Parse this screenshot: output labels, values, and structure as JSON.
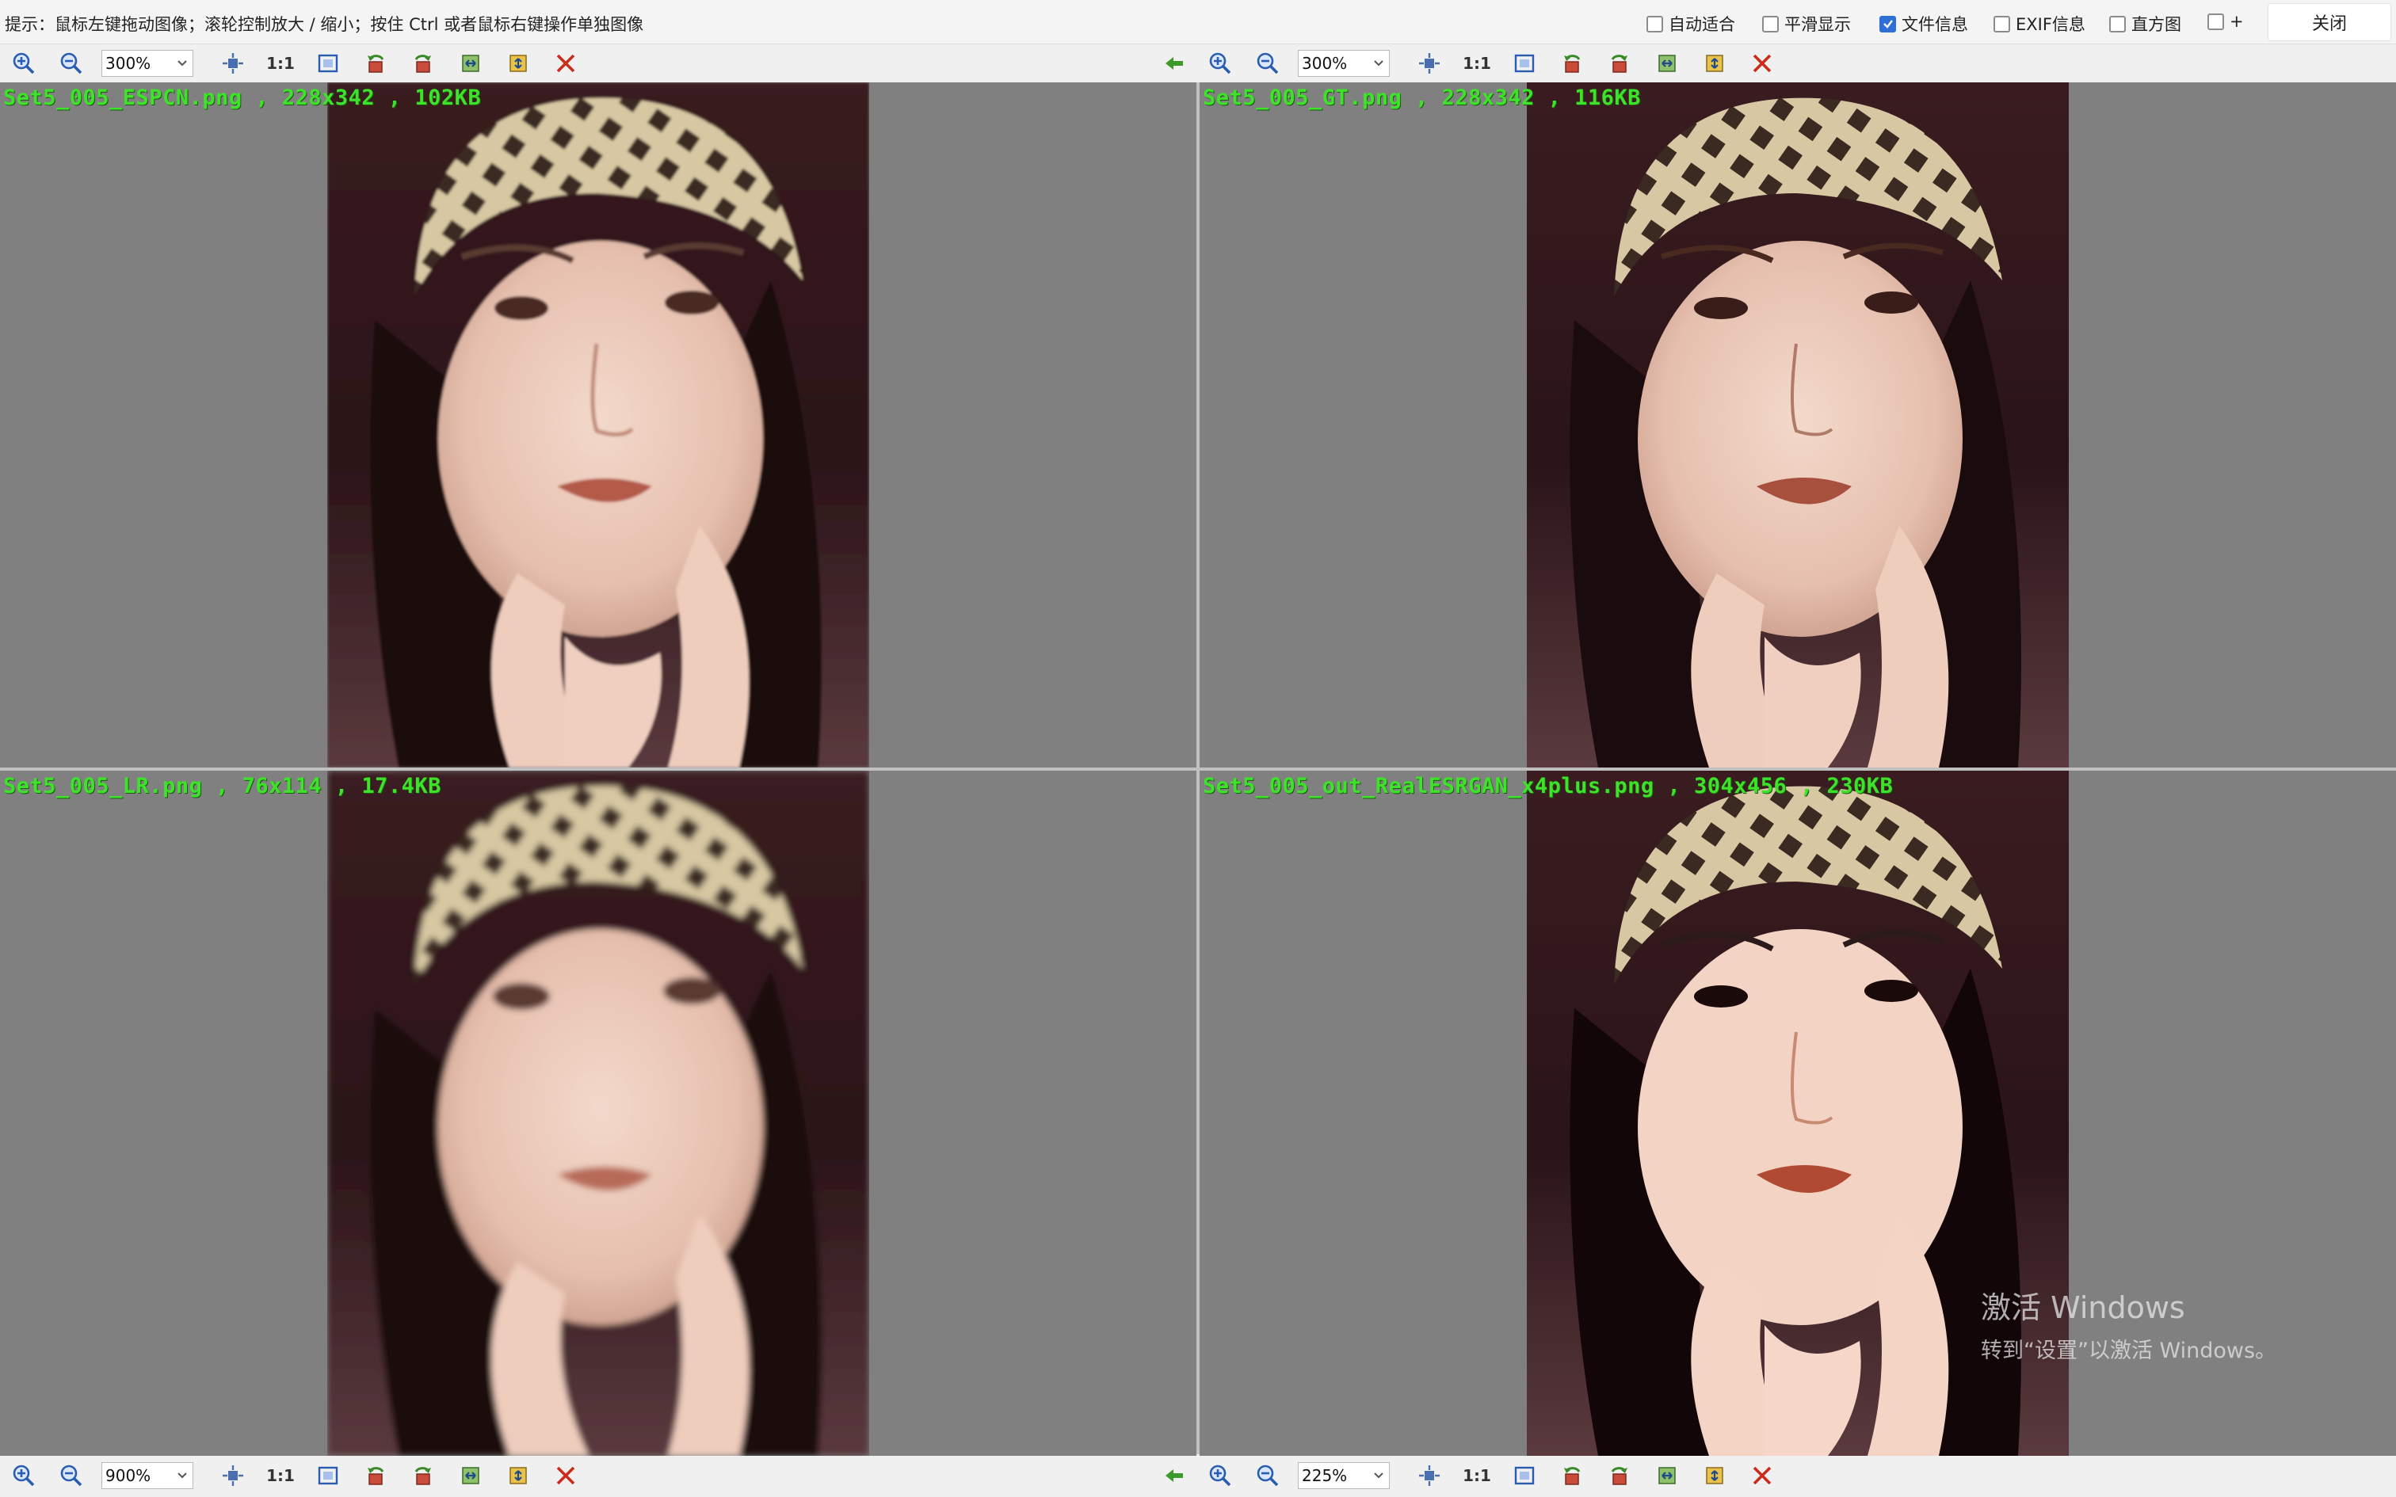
{
  "hint": "提示：鼠标左键拖动图像；滚轮控制放大 / 缩小；按住 Ctrl 或者鼠标右键操作单独图像",
  "options": [
    {
      "label": "自动适合",
      "checked": false
    },
    {
      "label": "平滑显示",
      "checked": false
    },
    {
      "label": "文件信息",
      "checked": true
    },
    {
      "label": "EXIF信息",
      "checked": false
    },
    {
      "label": "直方图",
      "checked": false
    },
    {
      "label": "+",
      "checked": false
    }
  ],
  "close_label": "关闭",
  "one_to_one": "1:1",
  "toolbars": {
    "top_left": {
      "zoom": "300%"
    },
    "top_right": {
      "zoom": "300%"
    },
    "bottom_left": {
      "zoom": "900%"
    },
    "bottom_right": {
      "zoom": "225%"
    }
  },
  "panes": {
    "top_left": {
      "label": "Set5_005_ESPCN.png , 228x342 , 102KB",
      "style": "smooth"
    },
    "top_right": {
      "label": "Set5_005_GT.png , 228x342 , 116KB",
      "style": "sharp"
    },
    "bottom_left": {
      "label": "Set5_005_LR.png , 76x114 , 17.4KB",
      "style": "pixelated"
    },
    "bottom_right": {
      "label": "Set5_005_out_RealESRGAN_x4plus.png , 304x456 , 230KB",
      "style": "enhanced"
    }
  },
  "watermark": {
    "line1": "激活 Windows",
    "line2": "转到“设置”以激活 Windows。"
  },
  "colors": {
    "label": "#3fe22a",
    "pane_bg": "#808080",
    "zoom_in": "#2a5db0",
    "close_red": "#cc2a1a"
  }
}
